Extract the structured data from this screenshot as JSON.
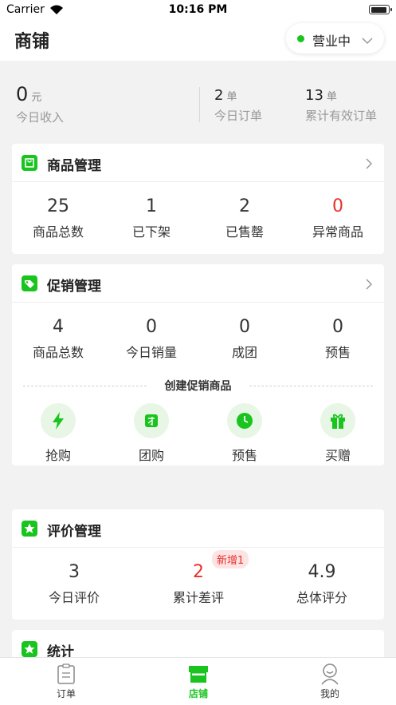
{
  "status_bar": {
    "carrier": "Carrier",
    "time": "10:16 PM"
  },
  "header": {
    "title": "商铺",
    "business_status": "营业中"
  },
  "overview": {
    "income": {
      "value": "0",
      "unit": "元",
      "label": "今日收入"
    },
    "orders": {
      "value": "2",
      "unit": "单",
      "label": "今日订单"
    },
    "valid_orders": {
      "value": "13",
      "unit": "单",
      "label": "累计有效订单"
    }
  },
  "goods": {
    "title": "商品管理",
    "stats": [
      {
        "value": "25",
        "label": "商品总数"
      },
      {
        "value": "1",
        "label": "已下架"
      },
      {
        "value": "2",
        "label": "已售罄"
      },
      {
        "value": "0",
        "label": "异常商品"
      }
    ]
  },
  "promo": {
    "title": "促销管理",
    "stats": [
      {
        "value": "4",
        "label": "商品总数"
      },
      {
        "value": "0",
        "label": "今日销量"
      },
      {
        "value": "0",
        "label": "成团"
      },
      {
        "value": "0",
        "label": "预售"
      }
    ],
    "create_title": "创建促销商品",
    "tools": [
      {
        "label": "抢购",
        "icon": "lightning-icon"
      },
      {
        "label": "团购",
        "icon": "group-buy-icon"
      },
      {
        "label": "预售",
        "icon": "clock-icon"
      },
      {
        "label": "买赠",
        "icon": "gift-icon"
      }
    ]
  },
  "reviews": {
    "title": "评价管理",
    "badge": "新增1",
    "stats": [
      {
        "value": "3",
        "label": "今日评价"
      },
      {
        "value": "2",
        "label": "累计差评"
      },
      {
        "value": "4.9",
        "label": "总体评分"
      }
    ]
  },
  "stats_section": {
    "title": "统计"
  },
  "tabbar": {
    "items": [
      {
        "label": "订单",
        "icon": "clipboard-icon"
      },
      {
        "label": "店铺",
        "icon": "store-icon"
      },
      {
        "label": "我的",
        "icon": "user-icon"
      }
    ]
  },
  "colors": {
    "accent": "#19c41f",
    "alert": "#e8312b",
    "background": "#f2f2f2"
  }
}
